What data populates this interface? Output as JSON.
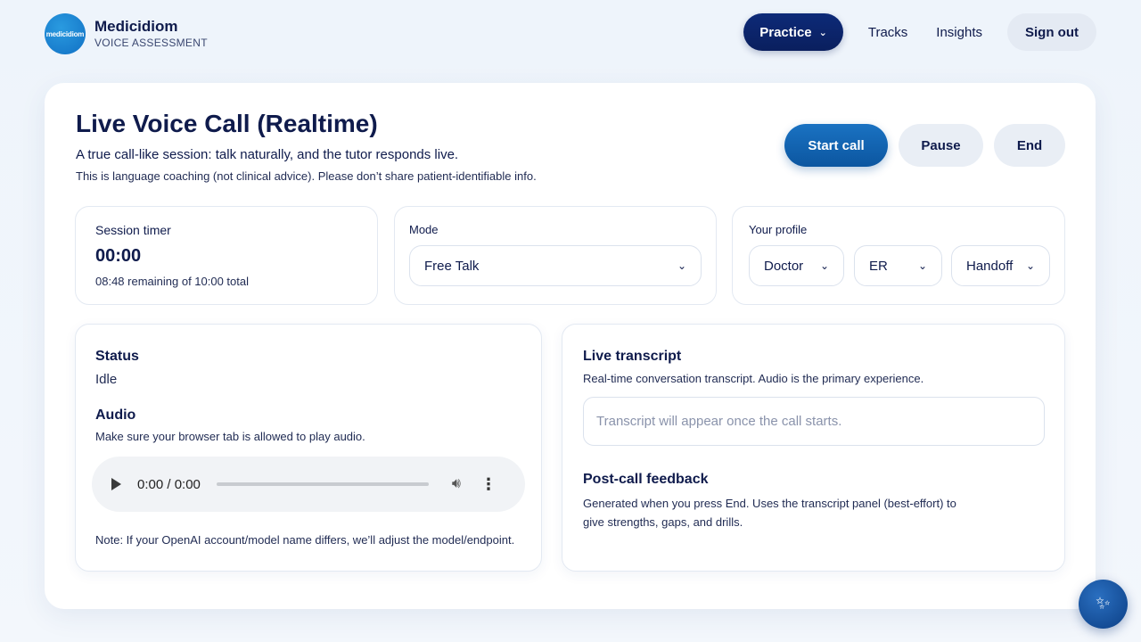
{
  "brand": {
    "logo_text": "medicidiom",
    "name": "Medicidiom",
    "subtitle": "VOICE ASSESSMENT"
  },
  "nav": {
    "practice": "Practice",
    "tracks": "Tracks",
    "insights": "Insights",
    "signout": "Sign out"
  },
  "page": {
    "title": "Live Voice Call (Realtime)",
    "subtitle": "A true call-like session: talk naturally, and the tutor responds live.",
    "disclaimer": "This is language coaching (not clinical advice). Please don’t share patient-identifiable info."
  },
  "actions": {
    "start": "Start call",
    "pause": "Pause",
    "end": "End"
  },
  "timer": {
    "label": "Session timer",
    "value": "00:00",
    "remaining": "08:48 remaining of 10:00 total"
  },
  "mode": {
    "label": "Mode",
    "selected": "Free Talk"
  },
  "profile": {
    "label": "Your profile",
    "role": "Doctor",
    "department": "ER",
    "scenario": "Handoff"
  },
  "status": {
    "heading": "Status",
    "value": "Idle",
    "audio_heading": "Audio",
    "audio_text": "Make sure your browser tab is allowed to play audio.",
    "player_time": "0:00 / 0:00",
    "note": "Note: If your OpenAI account/model name differs, we’ll adjust the model/endpoint."
  },
  "transcript": {
    "heading": "Live transcript",
    "text": "Real-time conversation transcript. Audio is the primary experience.",
    "placeholder": "Transcript will appear once the call starts.",
    "feedback_heading": "Post-call feedback",
    "feedback_text": "Generated when you press End. Uses the transcript panel (best-effort) to give strengths, gaps, and drills."
  },
  "icons": {
    "chevron": "chevron-down-icon",
    "play": "play-icon",
    "volume": "volume-icon",
    "more": "more-vertical-icon",
    "fab": "sparkle-icon"
  },
  "colors": {
    "primary": "#0c56a0",
    "nav_active": "#0a1f5e",
    "text": "#0f1b4c"
  }
}
